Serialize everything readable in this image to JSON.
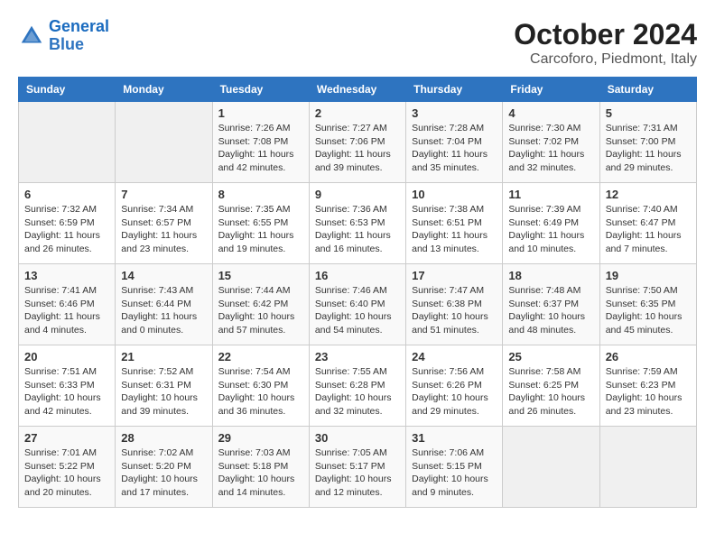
{
  "header": {
    "logo_line1": "General",
    "logo_line2": "Blue",
    "month": "October 2024",
    "location": "Carcoforo, Piedmont, Italy"
  },
  "columns": [
    "Sunday",
    "Monday",
    "Tuesday",
    "Wednesday",
    "Thursday",
    "Friday",
    "Saturday"
  ],
  "weeks": [
    [
      {
        "day": "",
        "info": ""
      },
      {
        "day": "",
        "info": ""
      },
      {
        "day": "1",
        "info": "Sunrise: 7:26 AM\nSunset: 7:08 PM\nDaylight: 11 hours and 42 minutes."
      },
      {
        "day": "2",
        "info": "Sunrise: 7:27 AM\nSunset: 7:06 PM\nDaylight: 11 hours and 39 minutes."
      },
      {
        "day": "3",
        "info": "Sunrise: 7:28 AM\nSunset: 7:04 PM\nDaylight: 11 hours and 35 minutes."
      },
      {
        "day": "4",
        "info": "Sunrise: 7:30 AM\nSunset: 7:02 PM\nDaylight: 11 hours and 32 minutes."
      },
      {
        "day": "5",
        "info": "Sunrise: 7:31 AM\nSunset: 7:00 PM\nDaylight: 11 hours and 29 minutes."
      }
    ],
    [
      {
        "day": "6",
        "info": "Sunrise: 7:32 AM\nSunset: 6:59 PM\nDaylight: 11 hours and 26 minutes."
      },
      {
        "day": "7",
        "info": "Sunrise: 7:34 AM\nSunset: 6:57 PM\nDaylight: 11 hours and 23 minutes."
      },
      {
        "day": "8",
        "info": "Sunrise: 7:35 AM\nSunset: 6:55 PM\nDaylight: 11 hours and 19 minutes."
      },
      {
        "day": "9",
        "info": "Sunrise: 7:36 AM\nSunset: 6:53 PM\nDaylight: 11 hours and 16 minutes."
      },
      {
        "day": "10",
        "info": "Sunrise: 7:38 AM\nSunset: 6:51 PM\nDaylight: 11 hours and 13 minutes."
      },
      {
        "day": "11",
        "info": "Sunrise: 7:39 AM\nSunset: 6:49 PM\nDaylight: 11 hours and 10 minutes."
      },
      {
        "day": "12",
        "info": "Sunrise: 7:40 AM\nSunset: 6:47 PM\nDaylight: 11 hours and 7 minutes."
      }
    ],
    [
      {
        "day": "13",
        "info": "Sunrise: 7:41 AM\nSunset: 6:46 PM\nDaylight: 11 hours and 4 minutes."
      },
      {
        "day": "14",
        "info": "Sunrise: 7:43 AM\nSunset: 6:44 PM\nDaylight: 11 hours and 0 minutes."
      },
      {
        "day": "15",
        "info": "Sunrise: 7:44 AM\nSunset: 6:42 PM\nDaylight: 10 hours and 57 minutes."
      },
      {
        "day": "16",
        "info": "Sunrise: 7:46 AM\nSunset: 6:40 PM\nDaylight: 10 hours and 54 minutes."
      },
      {
        "day": "17",
        "info": "Sunrise: 7:47 AM\nSunset: 6:38 PM\nDaylight: 10 hours and 51 minutes."
      },
      {
        "day": "18",
        "info": "Sunrise: 7:48 AM\nSunset: 6:37 PM\nDaylight: 10 hours and 48 minutes."
      },
      {
        "day": "19",
        "info": "Sunrise: 7:50 AM\nSunset: 6:35 PM\nDaylight: 10 hours and 45 minutes."
      }
    ],
    [
      {
        "day": "20",
        "info": "Sunrise: 7:51 AM\nSunset: 6:33 PM\nDaylight: 10 hours and 42 minutes."
      },
      {
        "day": "21",
        "info": "Sunrise: 7:52 AM\nSunset: 6:31 PM\nDaylight: 10 hours and 39 minutes."
      },
      {
        "day": "22",
        "info": "Sunrise: 7:54 AM\nSunset: 6:30 PM\nDaylight: 10 hours and 36 minutes."
      },
      {
        "day": "23",
        "info": "Sunrise: 7:55 AM\nSunset: 6:28 PM\nDaylight: 10 hours and 32 minutes."
      },
      {
        "day": "24",
        "info": "Sunrise: 7:56 AM\nSunset: 6:26 PM\nDaylight: 10 hours and 29 minutes."
      },
      {
        "day": "25",
        "info": "Sunrise: 7:58 AM\nSunset: 6:25 PM\nDaylight: 10 hours and 26 minutes."
      },
      {
        "day": "26",
        "info": "Sunrise: 7:59 AM\nSunset: 6:23 PM\nDaylight: 10 hours and 23 minutes."
      }
    ],
    [
      {
        "day": "27",
        "info": "Sunrise: 7:01 AM\nSunset: 5:22 PM\nDaylight: 10 hours and 20 minutes."
      },
      {
        "day": "28",
        "info": "Sunrise: 7:02 AM\nSunset: 5:20 PM\nDaylight: 10 hours and 17 minutes."
      },
      {
        "day": "29",
        "info": "Sunrise: 7:03 AM\nSunset: 5:18 PM\nDaylight: 10 hours and 14 minutes."
      },
      {
        "day": "30",
        "info": "Sunrise: 7:05 AM\nSunset: 5:17 PM\nDaylight: 10 hours and 12 minutes."
      },
      {
        "day": "31",
        "info": "Sunrise: 7:06 AM\nSunset: 5:15 PM\nDaylight: 10 hours and 9 minutes."
      },
      {
        "day": "",
        "info": ""
      },
      {
        "day": "",
        "info": ""
      }
    ]
  ]
}
